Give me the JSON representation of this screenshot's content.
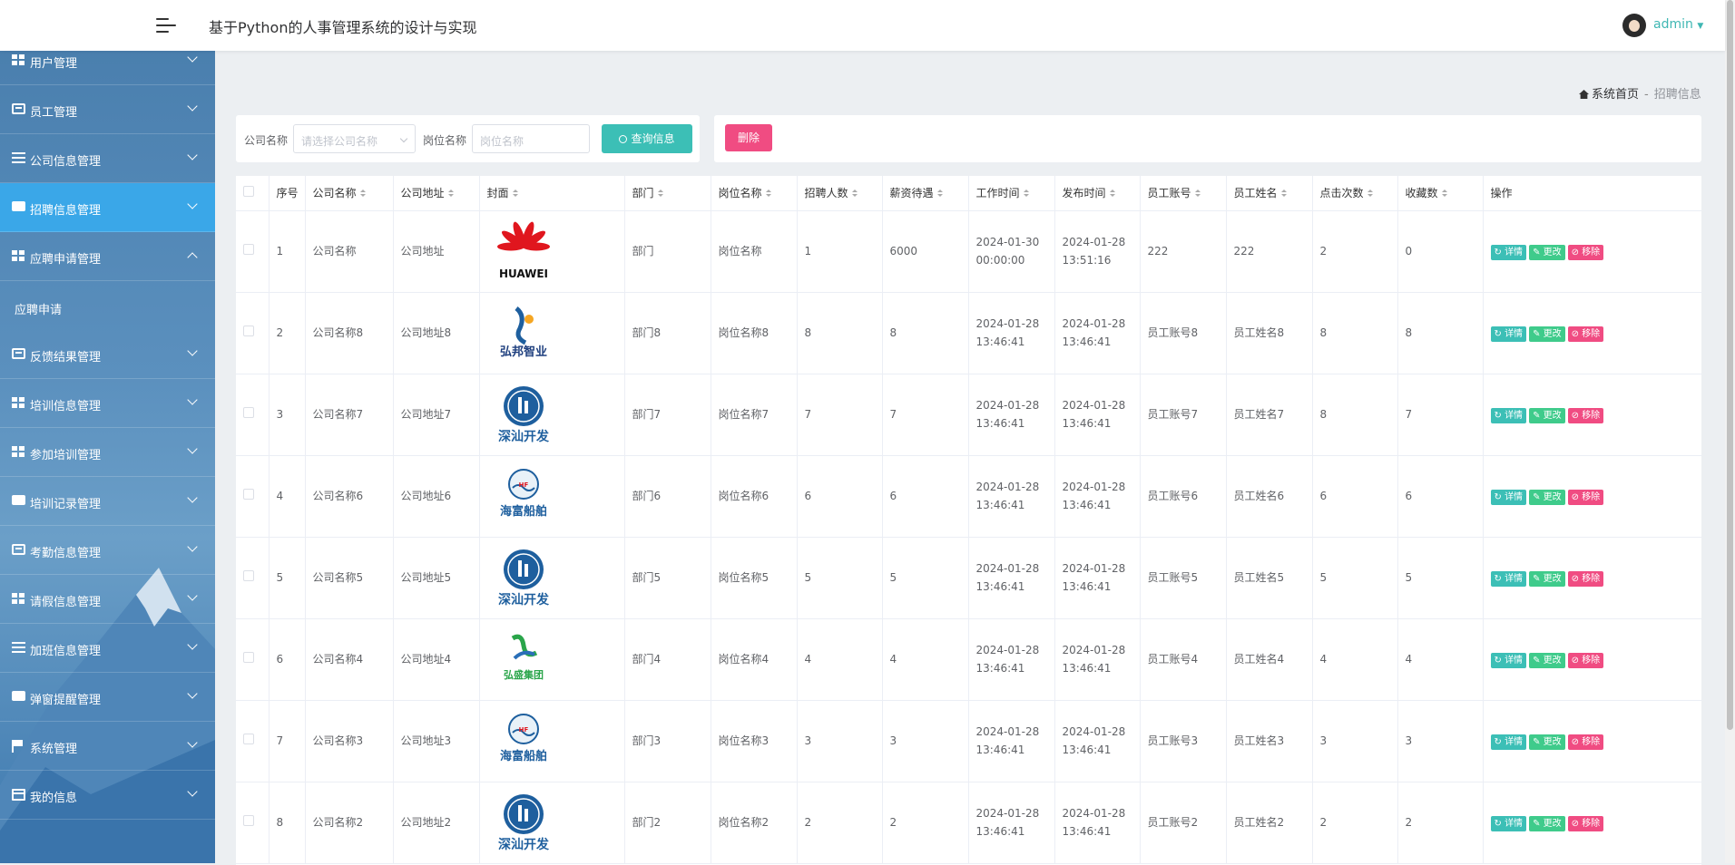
{
  "header": {
    "title": "基于Python的人事管理系统的设计与实现",
    "user": "admin"
  },
  "sidebar": {
    "items": [
      {
        "label": "用户管理",
        "icon": "grid-icon",
        "state": "collapsed"
      },
      {
        "label": "员工管理",
        "icon": "briefcase-icon",
        "state": "collapsed"
      },
      {
        "label": "公司信息管理",
        "icon": "list-icon",
        "state": "collapsed"
      },
      {
        "label": "招聘信息管理",
        "icon": "board-icon",
        "state": "active"
      },
      {
        "label": "应聘申请管理",
        "icon": "grid-icon",
        "state": "expanded"
      },
      {
        "label": "反馈结果管理",
        "icon": "briefcase-icon",
        "state": "collapsed"
      },
      {
        "label": "培训信息管理",
        "icon": "grid-icon",
        "state": "collapsed"
      },
      {
        "label": "参加培训管理",
        "icon": "grid-icon",
        "state": "collapsed"
      },
      {
        "label": "培训记录管理",
        "icon": "chat-icon",
        "state": "collapsed"
      },
      {
        "label": "考勤信息管理",
        "icon": "ticket-icon",
        "state": "collapsed"
      },
      {
        "label": "请假信息管理",
        "icon": "grid-icon",
        "state": "collapsed"
      },
      {
        "label": "加班信息管理",
        "icon": "list-icon",
        "state": "collapsed"
      },
      {
        "label": "弹窗提醒管理",
        "icon": "board-icon",
        "state": "collapsed"
      },
      {
        "label": "系统管理",
        "icon": "flag-icon",
        "state": "collapsed"
      },
      {
        "label": "我的信息",
        "icon": "window-icon",
        "state": "collapsed"
      }
    ],
    "submenu": {
      "label": "应聘申请"
    }
  },
  "breadcrumb": {
    "home": "系统首页",
    "separator": "-",
    "current": "招聘信息"
  },
  "search": {
    "company_label": "公司名称",
    "company_placeholder": "请选择公司名称",
    "position_label": "岗位名称",
    "position_placeholder": "岗位名称",
    "search_button": "查询信息",
    "delete_button": "删除"
  },
  "table": {
    "columns": [
      "序号",
      "公司名称",
      "公司地址",
      "封面",
      "部门",
      "岗位名称",
      "招聘人数",
      "薪资待遇",
      "工作时间",
      "发布时间",
      "员工账号",
      "员工姓名",
      "点击次数",
      "收藏数",
      "操作"
    ],
    "actions": {
      "detail": "详情",
      "edit": "更改",
      "remove": "移除"
    },
    "rows": [
      {
        "index": "1",
        "company": "公司名称",
        "address": "公司地址",
        "logo": "HUAWEI",
        "dept": "部门",
        "position": "岗位名称",
        "hires": "1",
        "salary": "6000",
        "work_time": "2024-01-30 00:00:00",
        "publish_time": "2024-01-28 13:51:16",
        "account": "222",
        "name": "222",
        "clicks": "2",
        "favorites": "0"
      },
      {
        "index": "2",
        "company": "公司名称8",
        "address": "公司地址8",
        "logo": "弘邦智业",
        "dept": "部门8",
        "position": "岗位名称8",
        "hires": "8",
        "salary": "8",
        "work_time": "2024-01-28 13:46:41",
        "publish_time": "2024-01-28 13:46:41",
        "account": "员工账号8",
        "name": "员工姓名8",
        "clicks": "8",
        "favorites": "8"
      },
      {
        "index": "3",
        "company": "公司名称7",
        "address": "公司地址7",
        "logo": "深汕开发",
        "dept": "部门7",
        "position": "岗位名称7",
        "hires": "7",
        "salary": "7",
        "work_time": "2024-01-28 13:46:41",
        "publish_time": "2024-01-28 13:46:41",
        "account": "员工账号7",
        "name": "员工姓名7",
        "clicks": "8",
        "favorites": "7"
      },
      {
        "index": "4",
        "company": "公司名称6",
        "address": "公司地址6",
        "logo": "海富船舶",
        "dept": "部门6",
        "position": "岗位名称6",
        "hires": "6",
        "salary": "6",
        "work_time": "2024-01-28 13:46:41",
        "publish_time": "2024-01-28 13:46:41",
        "account": "员工账号6",
        "name": "员工姓名6",
        "clicks": "6",
        "favorites": "6"
      },
      {
        "index": "5",
        "company": "公司名称5",
        "address": "公司地址5",
        "logo": "深汕开发",
        "dept": "部门5",
        "position": "岗位名称5",
        "hires": "5",
        "salary": "5",
        "work_time": "2024-01-28 13:46:41",
        "publish_time": "2024-01-28 13:46:41",
        "account": "员工账号5",
        "name": "员工姓名5",
        "clicks": "5",
        "favorites": "5"
      },
      {
        "index": "6",
        "company": "公司名称4",
        "address": "公司地址4",
        "logo": "弘盛集团",
        "dept": "部门4",
        "position": "岗位名称4",
        "hires": "4",
        "salary": "4",
        "work_time": "2024-01-28 13:46:41",
        "publish_time": "2024-01-28 13:46:41",
        "account": "员工账号4",
        "name": "员工姓名4",
        "clicks": "4",
        "favorites": "4"
      },
      {
        "index": "7",
        "company": "公司名称3",
        "address": "公司地址3",
        "logo": "海富船舶",
        "dept": "部门3",
        "position": "岗位名称3",
        "hires": "3",
        "salary": "3",
        "work_time": "2024-01-28 13:46:41",
        "publish_time": "2024-01-28 13:46:41",
        "account": "员工账号3",
        "name": "员工姓名3",
        "clicks": "3",
        "favorites": "3"
      },
      {
        "index": "8",
        "company": "公司名称2",
        "address": "公司地址2",
        "logo": "深汕开发",
        "dept": "部门2",
        "position": "岗位名称2",
        "hires": "2",
        "salary": "2",
        "work_time": "2024-01-28 13:46:41",
        "publish_time": "2024-01-28 13:46:41",
        "account": "员工账号2",
        "name": "员工姓名2",
        "clicks": "2",
        "favorites": "2"
      }
    ]
  },
  "colors": {
    "accent": "#3cbfb6",
    "edit": "#3fcb8b",
    "danger": "#f04c82",
    "active_menu": "#3aa7e8"
  }
}
